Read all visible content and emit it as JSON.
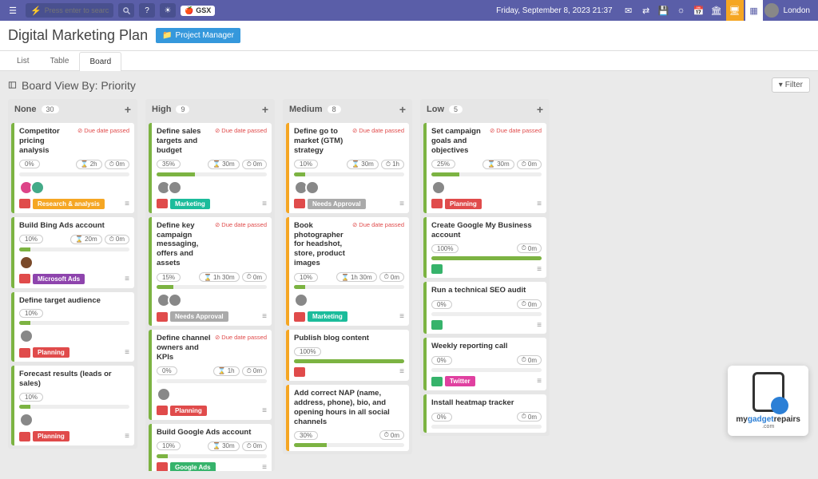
{
  "header": {
    "search_placeholder": "Press enter to search",
    "gsx_label": "GSX",
    "datetime": "Friday, September 8, 2023 21:37",
    "location": "London"
  },
  "page": {
    "title": "Digital Marketing Plan",
    "pm_badge": "Project Manager"
  },
  "tabs": {
    "list": "List",
    "table": "Table",
    "board": "Board"
  },
  "board_view_title": "Board View By: Priority",
  "filter_label": "Filter",
  "due_passed_label": "Due date passed",
  "columns": {
    "none": {
      "name": "None",
      "count": "30"
    },
    "high": {
      "name": "High",
      "count": "9"
    },
    "medium": {
      "name": "Medium",
      "count": "8"
    },
    "low": {
      "name": "Low",
      "count": "5"
    }
  },
  "cards": {
    "n1": {
      "title": "Competitor pricing analysis",
      "pct": "0%",
      "est": "2h",
      "act": "0m",
      "tag": "Research & analysis"
    },
    "n2": {
      "title": "Build Bing Ads account",
      "pct": "10%",
      "est": "20m",
      "act": "0m",
      "tag": "Microsoft Ads"
    },
    "n3": {
      "title": "Define target audience",
      "pct": "10%",
      "tag": "Planning"
    },
    "n4": {
      "title": "Forecast results (leads or sales)",
      "pct": "10%",
      "tag": "Planning"
    },
    "h1": {
      "title": "Define sales targets and budget",
      "pct": "35%",
      "est": "30m",
      "act": "0m",
      "tag": "Marketing"
    },
    "h2": {
      "title": "Define key campaign messaging, offers and assets",
      "pct": "15%",
      "est": "1h 30m",
      "act": "0m",
      "tag": "Needs Approval"
    },
    "h3": {
      "title": "Define channel owners and KPIs",
      "pct": "0%",
      "est": "1h",
      "act": "0m",
      "tag": "Planning"
    },
    "h4": {
      "title": "Build Google Ads account",
      "pct": "10%",
      "est": "30m",
      "act": "0m",
      "tag": "Google Ads"
    },
    "m1": {
      "title": "Define go to market (GTM) strategy",
      "pct": "10%",
      "est": "30m",
      "act": "1h",
      "tag": "Needs Approval"
    },
    "m2": {
      "title": "Book photographer for headshot, store, product images",
      "pct": "10%",
      "est": "1h 30m",
      "act": "0m",
      "tag": "Marketing"
    },
    "m3": {
      "title": "Publish blog content",
      "pct": "100%"
    },
    "m4": {
      "title": "Add correct NAP (name, address, phone), bio, and opening hours in all social channels",
      "pct": "30%",
      "act": "0m"
    },
    "l1": {
      "title": "Set campaign goals and objectives",
      "pct": "25%",
      "est": "30m",
      "act": "0m",
      "tag": "Planning"
    },
    "l2": {
      "title": "Create Google My Business account",
      "pct": "100%",
      "act": "0m"
    },
    "l3": {
      "title": "Run a technical SEO audit",
      "pct": "0%",
      "act": "0m"
    },
    "l4": {
      "title": "Weekly reporting call",
      "pct": "0%",
      "act": "0m",
      "tag": "Twitter"
    },
    "l5": {
      "title": "Install heatmap tracker",
      "pct": "0%",
      "act": "0m"
    }
  }
}
